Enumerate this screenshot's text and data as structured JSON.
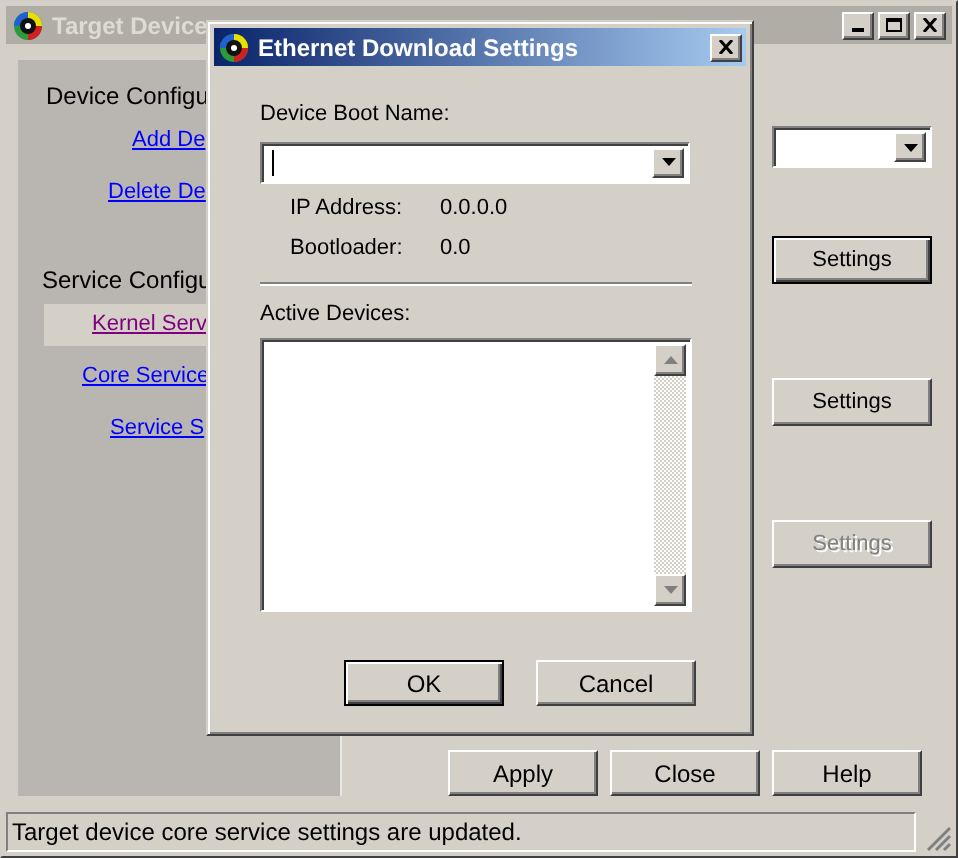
{
  "main_window": {
    "title": "Target Device",
    "active": false
  },
  "sidebar": {
    "sections": [
      {
        "heading": "Device Configu",
        "items": [
          {
            "label": "Add De",
            "selected": false
          },
          {
            "label": "Delete De",
            "selected": false
          }
        ]
      },
      {
        "heading": "Service Configu",
        "items": [
          {
            "label": "Kernel Serv",
            "selected": true
          },
          {
            "label": "Core Service",
            "selected": false
          },
          {
            "label": "Service S",
            "selected": false
          }
        ]
      }
    ]
  },
  "settings_buttons": [
    {
      "label": "Settings",
      "focused": true,
      "disabled": false
    },
    {
      "label": "Settings",
      "focused": false,
      "disabled": false
    },
    {
      "label": "Settings",
      "focused": false,
      "disabled": true
    }
  ],
  "buttons": [
    "Apply",
    "Close",
    "Help"
  ],
  "status_bar": "Target device core service settings are updated.",
  "dialog": {
    "title": "Ethernet Download Settings",
    "boot_name_label": "Device Boot Name:",
    "info": [
      {
        "label": "IP Address:",
        "value": "0.0.0.0"
      },
      {
        "label": "Bootloader:",
        "value": "0.0"
      }
    ],
    "active_devices_label": "Active Devices:",
    "buttons": [
      {
        "label": "OK",
        "default": true
      },
      {
        "label": "Cancel",
        "default": false
      }
    ]
  }
}
